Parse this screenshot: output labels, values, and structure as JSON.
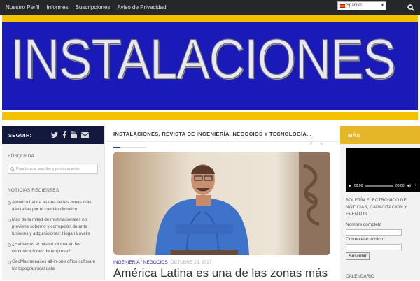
{
  "topnav": {
    "items": [
      {
        "label": "Nuestro Perfil"
      },
      {
        "label": "Informes"
      },
      {
        "label": "Suscripciones"
      },
      {
        "label": "Aviso de Privacidad"
      }
    ],
    "language": "Spanish"
  },
  "banner": {
    "title": "INSTALACIONES"
  },
  "left": {
    "follow_label": "SEGUIR:",
    "search_label": "BÚSQUEDA",
    "search_placeholder": "Para buscar, escribe y presiona enter",
    "recent_label": "NOTICIAS RECIENTES",
    "recent_items": [
      {
        "text": "América Latina es una de las zonas más afectadas por el cambio climático"
      },
      {
        "text": "Más de la mitad de multinacionales no previene soborno y corrupción durante fusiones y adquisiciones: Hogan Lovells"
      },
      {
        "text": "¿Hablamos el mismo idioma en las comunicaciones de empresa?"
      },
      {
        "text": "GeoMax releases all-in-one office software for topographical data"
      }
    ]
  },
  "center": {
    "header": "INSTALACIONES, REVISTA DE INGENIERÍA, NEGOCIOS Y TECNOLOGÍA...",
    "category1": "INGENIERÍA",
    "category2": "NEGOCIOS",
    "date": "OCTUBRE 23, 2017",
    "headline": "América Latina es una de las zonas más"
  },
  "right": {
    "header": "MÁS",
    "player_time_current": "00:00",
    "player_time_total": "00:00",
    "boletin": "BOLETÍN ELECTRÓNICO DE NOTICIAS, CAPACITACIÓN Y EVENTOS",
    "name_label": "Nombre completo",
    "email_label": "Correo electrónico",
    "submit_label": "Suscribir",
    "calendar_label": "CALENDARIO"
  },
  "colors": {
    "topbar": "#26272b",
    "banner_blue": "#1a1ab8",
    "banner_yellow": "#f2c200",
    "follow_bar": "#13193d",
    "mas_bar": "#e4b628"
  }
}
